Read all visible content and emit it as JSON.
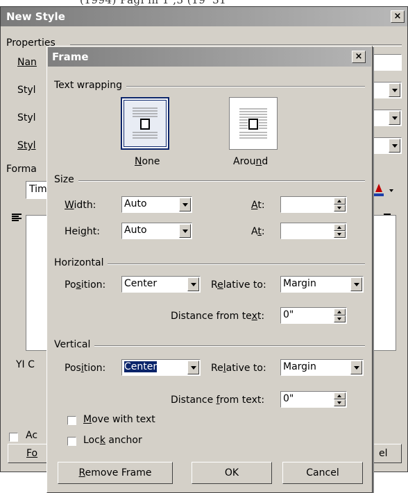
{
  "background": {
    "top_text": "(1994) Pagi in 1 ,3 (19' 31"
  },
  "new_style": {
    "title": "New Style",
    "properties_label": "Properties",
    "name_label_partial": "Nan",
    "style_labels": [
      "Styl",
      "Styl",
      "Styl"
    ],
    "formatting_label_partial": "Forma",
    "font_value_partial": "Tim",
    "description_partial": "YI C",
    "add_checkbox_label_partial": "Ac",
    "format_button_partial": "Fo",
    "cancel_button_partial": "el"
  },
  "frame": {
    "title": "Frame",
    "text_wrapping": {
      "group_label": "Text wrapping",
      "options": [
        {
          "label_pre": "",
          "label_u": "N",
          "label_post": "one",
          "selected": true
        },
        {
          "label_pre": "Arou",
          "label_u": "n",
          "label_post": "d",
          "selected": false
        }
      ]
    },
    "size": {
      "group_label": "Size",
      "width_label_pre": "",
      "width_label_u": "W",
      "width_label_post": "idth:",
      "width_value": "Auto",
      "height_label_pre": "Hei",
      "height_label_u": "g",
      "height_label_post": "ht:",
      "height_value": "Auto",
      "at1_label_pre": "",
      "at1_label_u": "A",
      "at1_label_post": "t:",
      "at1_value": "",
      "at2_label_pre": "A",
      "at2_label_u": "t",
      "at2_label_post": ":",
      "at2_value": ""
    },
    "horizontal": {
      "group_label": "Horizontal",
      "position_label_pre": "Po",
      "position_label_u": "s",
      "position_label_post": "ition:",
      "position_value": "Center",
      "relative_label_pre": "R",
      "relative_label_u": "e",
      "relative_label_post": "lative to:",
      "relative_value": "Margin",
      "distance_label_pre": "Distance from te",
      "distance_label_u": "x",
      "distance_label_post": "t:",
      "distance_value": "0\""
    },
    "vertical": {
      "group_label": "Vertical",
      "position_label_pre": "Pos",
      "position_label_u": "i",
      "position_label_post": "tion:",
      "position_value": "Center",
      "relative_label_pre": "Re",
      "relative_label_u": "l",
      "relative_label_post": "ative to:",
      "relative_value": "Margin",
      "distance_label_pre": "Distance ",
      "distance_label_u": "f",
      "distance_label_post": "rom text:",
      "distance_value": "0\""
    },
    "move_with_text_pre": "",
    "move_with_text_u": "M",
    "move_with_text_post": "ove with text",
    "lock_anchor_pre": "Loc",
    "lock_anchor_u": "k",
    "lock_anchor_post": " anchor",
    "buttons": {
      "remove_pre": "",
      "remove_u": "R",
      "remove_post": "emove Frame",
      "ok": "OK",
      "cancel": "Cancel"
    },
    "close_glyph": "×"
  },
  "colors": {
    "selection": "#0a246a",
    "dialog_face": "#d4d0c8"
  }
}
